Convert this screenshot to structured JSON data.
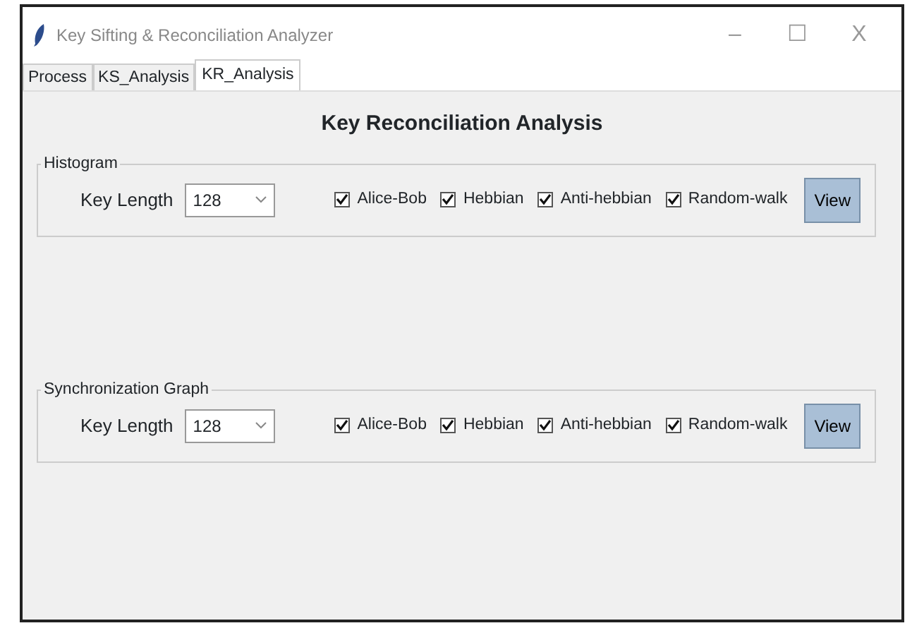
{
  "window": {
    "title": "Key Sifting & Reconciliation Analyzer",
    "controls": [
      "–",
      "☐",
      "X"
    ]
  },
  "tabs": [
    {
      "label": "Process",
      "selected": false
    },
    {
      "label": "KS_Analysis",
      "selected": false
    },
    {
      "label": "KR_Analysis",
      "selected": true
    }
  ],
  "heading": "Key Reconciliation Analysis",
  "groups": [
    {
      "title": "Histogram",
      "key_length_label": "Key Length",
      "key_length": "128",
      "checkboxes": [
        {
          "label": "Alice-Bob",
          "checked": true
        },
        {
          "label": "Hebbian",
          "checked": true
        },
        {
          "label": "Anti-hebbian",
          "checked": true
        },
        {
          "label": "Random-walk",
          "checked": true
        }
      ],
      "button": "View"
    },
    {
      "title": "Synchronization Graph",
      "key_length_label": "Key Length",
      "key_length": "128",
      "checkboxes": [
        {
          "label": "Alice-Bob",
          "checked": true
        },
        {
          "label": "Hebbian",
          "checked": true
        },
        {
          "label": "Anti-hebbian",
          "checked": true
        },
        {
          "label": "Random-walk",
          "checked": true
        }
      ],
      "button": "View"
    }
  ]
}
